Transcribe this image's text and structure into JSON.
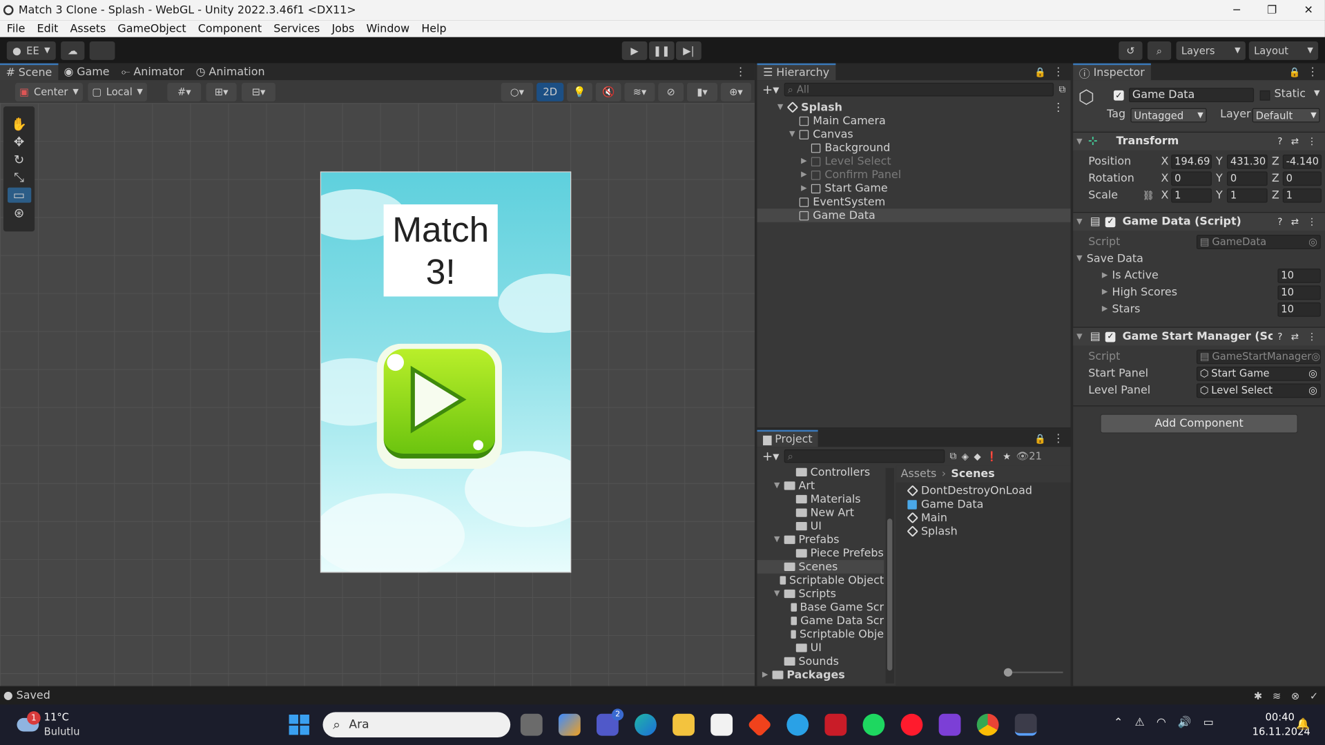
{
  "window": {
    "title": "Match 3 Clone - Splash - WebGL - Unity 2022.3.46f1 <DX11>",
    "controls": [
      "─",
      "❐",
      "✕"
    ]
  },
  "menu": [
    "File",
    "Edit",
    "Assets",
    "GameObject",
    "Component",
    "Services",
    "Jobs",
    "Window",
    "Help"
  ],
  "toolbar": {
    "account": "EE",
    "layers": "Layers",
    "layout": "Layout"
  },
  "scene": {
    "tabs": [
      "Scene",
      "Game",
      "Animator",
      "Animation"
    ],
    "pivot": "Center",
    "space": "Local",
    "mode2d": "2D",
    "game_title": "Match 3!"
  },
  "hierarchy": {
    "tab": "Hierarchy",
    "search_placeholder": "All",
    "items": [
      {
        "label": "Splash",
        "depth": 0,
        "type": "scene",
        "expanded": true
      },
      {
        "label": "Main Camera",
        "depth": 1,
        "type": "go"
      },
      {
        "label": "Canvas",
        "depth": 1,
        "type": "go",
        "expanded": true
      },
      {
        "label": "Background",
        "depth": 2,
        "type": "go"
      },
      {
        "label": "Level Select",
        "depth": 2,
        "type": "go",
        "collapsed": true,
        "inactive": true
      },
      {
        "label": "Confirm Panel",
        "depth": 2,
        "type": "go",
        "collapsed": true,
        "inactive": true
      },
      {
        "label": "Start Game",
        "depth": 2,
        "type": "go",
        "collapsed": true
      },
      {
        "label": "EventSystem",
        "depth": 1,
        "type": "go"
      },
      {
        "label": "Game Data",
        "depth": 1,
        "type": "go",
        "selected": true
      }
    ]
  },
  "inspector": {
    "tab": "Inspector",
    "name": "Game Data",
    "static_label": "Static",
    "tag_label": "Tag",
    "tag": "Untagged",
    "layer_label": "Layer",
    "layer": "Default",
    "transform": {
      "title": "Transform",
      "position_label": "Position",
      "rotation_label": "Rotation",
      "scale_label": "Scale",
      "position": {
        "x": "194.69",
        "y": "431.30",
        "z": "-4.140"
      },
      "rotation": {
        "x": "0",
        "y": "0",
        "z": "0"
      },
      "scale": {
        "x": "1",
        "y": "1",
        "z": "1"
      }
    },
    "gamedata": {
      "title": "Game Data (Script)",
      "script_label": "Script",
      "script": "GameData",
      "save_data": "Save Data",
      "fields": [
        {
          "label": "Is Active",
          "value": "10"
        },
        {
          "label": "High Scores",
          "value": "10"
        },
        {
          "label": "Stars",
          "value": "10"
        }
      ]
    },
    "gsm": {
      "title": "Game Start Manager (Script)",
      "script_label": "Script",
      "script": "GameStartManager",
      "start_panel_label": "Start Panel",
      "start_panel": "Start Game",
      "level_panel_label": "Level Panel",
      "level_panel": "Level Select"
    },
    "add_component": "Add Component"
  },
  "project": {
    "tab": "Project",
    "count": "21",
    "tree": [
      {
        "label": "Controllers",
        "depth": 2
      },
      {
        "label": "Art",
        "depth": 1,
        "expanded": true
      },
      {
        "label": "Materials",
        "depth": 2
      },
      {
        "label": "New Art",
        "depth": 2
      },
      {
        "label": "UI",
        "depth": 2
      },
      {
        "label": "Prefabs",
        "depth": 1,
        "expanded": true
      },
      {
        "label": "Piece Prefebs",
        "depth": 2
      },
      {
        "label": "Scenes",
        "depth": 1,
        "selected": true
      },
      {
        "label": "Scriptable Object",
        "depth": 1
      },
      {
        "label": "Scripts",
        "depth": 1,
        "expanded": true
      },
      {
        "label": "Base Game Scr",
        "depth": 2
      },
      {
        "label": "Game Data Scr",
        "depth": 2
      },
      {
        "label": "Scriptable Obje",
        "depth": 2
      },
      {
        "label": "UI",
        "depth": 2
      },
      {
        "label": "Sounds",
        "depth": 1
      },
      {
        "label": "Packages",
        "depth": 0,
        "collapsed": true
      }
    ],
    "breadcrumb": [
      "Assets",
      "Scenes"
    ],
    "files": [
      {
        "label": "DontDestroyOnLoad",
        "type": "scene"
      },
      {
        "label": "Game Data",
        "type": "asset"
      },
      {
        "label": "Main",
        "type": "scene"
      },
      {
        "label": "Splash",
        "type": "scene"
      }
    ]
  },
  "status": {
    "text": "Saved"
  },
  "taskbar": {
    "temp": "11°C",
    "weather": "Bulutlu",
    "weather_badge": "1",
    "search": "Ara",
    "teams_badge": "2",
    "time": "00:40",
    "date": "16.11.2024"
  }
}
